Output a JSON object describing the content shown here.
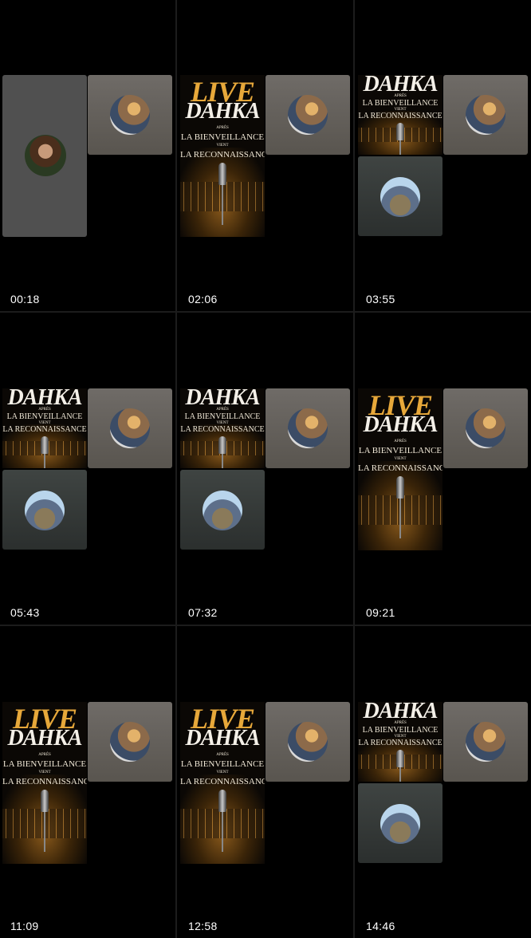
{
  "cells": [
    {
      "timestamp": "00:18"
    },
    {
      "timestamp": "02:06"
    },
    {
      "timestamp": "03:55"
    },
    {
      "timestamp": "05:43"
    },
    {
      "timestamp": "07:32"
    },
    {
      "timestamp": "09:21"
    },
    {
      "timestamp": "11:09"
    },
    {
      "timestamp": "12:58"
    },
    {
      "timestamp": "14:46"
    }
  ],
  "poster": {
    "live": "LIVE",
    "dahka": "DAHKA",
    "apres": "APRÈS",
    "line1": "LA BIENVEILLANCE",
    "vient": "VIENT",
    "line2": "LA RECONNAISSANCE"
  },
  "icons": {
    "grid_background": "#000000",
    "avatar_tile_color": "#66625d",
    "flag_tile_color": "#353a39"
  }
}
